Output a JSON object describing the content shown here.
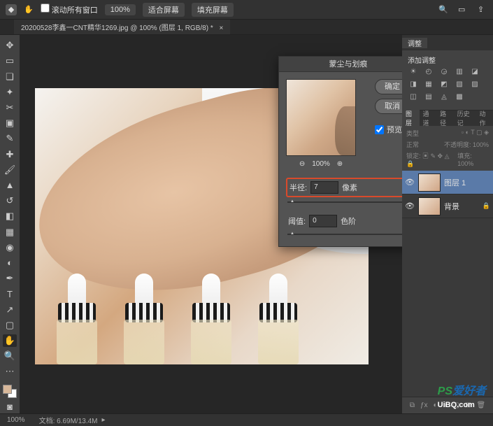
{
  "topbar": {
    "fit_window": "滚动所有窗口",
    "zoom_level": "100%",
    "fit_screen": "适合屏幕",
    "fill_screen": "填充屏幕"
  },
  "tab": {
    "filename": "20200528李鑫一CNT精华1269.jpg @ 100% (图层 1, RGB/8) *",
    "close": "×"
  },
  "dialog": {
    "title": "蒙尘与划痕",
    "ok": "确定",
    "cancel": "取消",
    "preview_label": "预览",
    "zoom": "100%",
    "radius_label": "半径:",
    "radius_value": "7",
    "radius_unit": "像素",
    "threshold_label": "阈值:",
    "threshold_value": "0",
    "threshold_unit": "色阶"
  },
  "panels": {
    "adjust_tab": "调整",
    "add_adjust": "添加调整",
    "layer_tabs": [
      "图层",
      "通道",
      "路径",
      "历史记",
      "动作"
    ],
    "kind_label": "类型",
    "blend": "正常",
    "opacity_label": "不透明度",
    "opacity_val": "100%",
    "lock_label": "锁定",
    "fill_label": "填充",
    "fill_val": "100%",
    "layers": [
      {
        "name": "图层 1"
      },
      {
        "name": "背景"
      }
    ]
  },
  "status": {
    "zoom": "100%",
    "doc": "文档: 6.69M/13.4M"
  },
  "watermark": {
    "site": "UiBQ.com",
    "brand_a": "PS",
    "brand_b": "爱好者"
  }
}
